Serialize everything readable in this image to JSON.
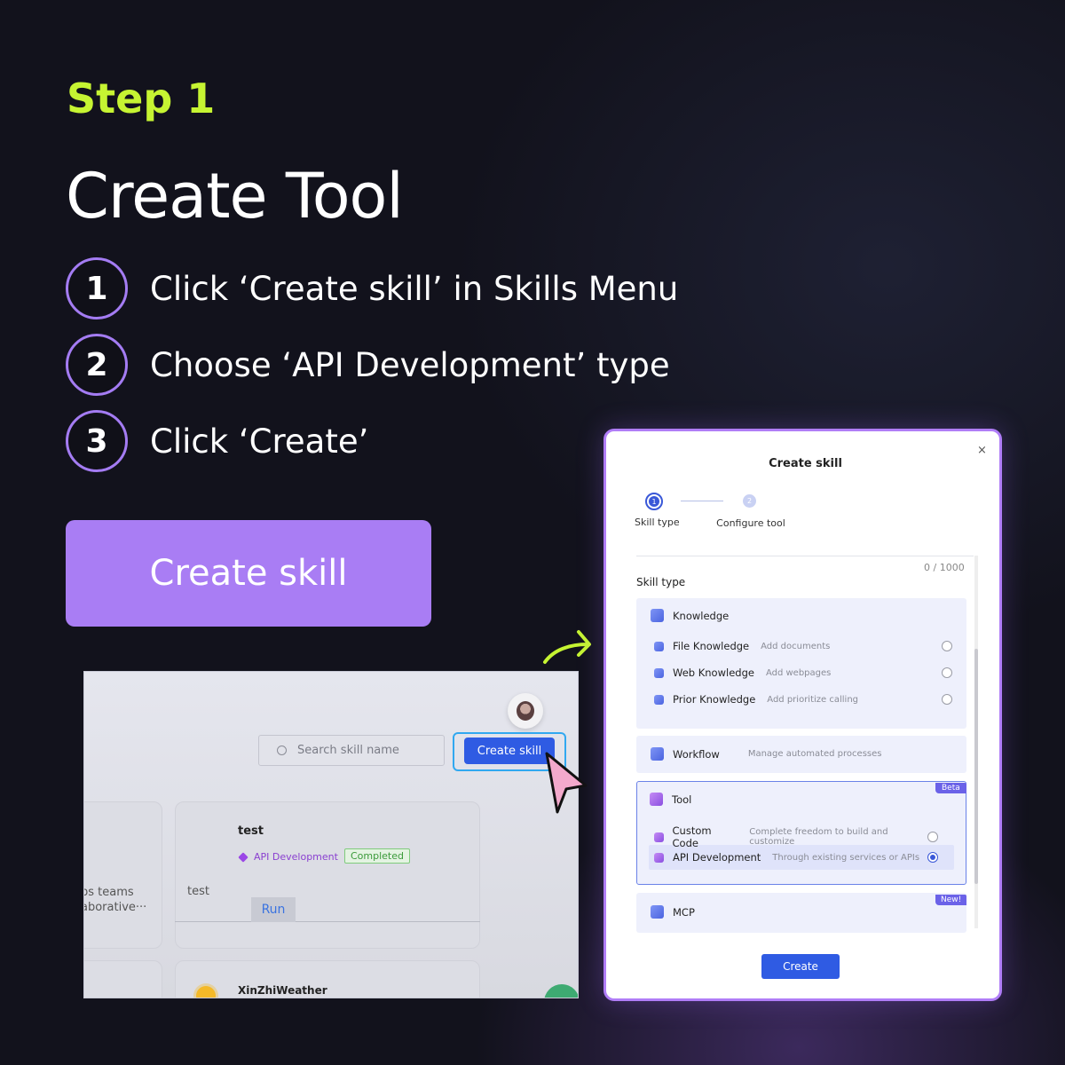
{
  "header": {
    "step_label": "Step 1",
    "title": "Create Tool"
  },
  "steps": [
    {
      "number": "1",
      "text": "Click ‘Create skill’ in Skills Menu"
    },
    {
      "number": "2",
      "text": "Choose ‘API Development’ type"
    },
    {
      "number": "3",
      "text": "Click ‘Create’"
    }
  ],
  "cta_label": "Create skill",
  "screenshot": {
    "search_placeholder": "Search skill name",
    "create_button": "Create skill",
    "card": {
      "name": "test",
      "tag": "API Development",
      "status": "Completed",
      "description": "test",
      "run_label": "Run"
    },
    "truncated_lines": [
      "ps teams",
      "aborative···"
    ],
    "second_card_name": "XinZhiWeather"
  },
  "dialog": {
    "title": "Create skill",
    "close": "×",
    "stepper": [
      {
        "num": "1",
        "label": "Skill type"
      },
      {
        "num": "2",
        "label": "Configure tool"
      }
    ],
    "counter": "0 / 1000",
    "section_label": "Skill type",
    "knowledge": {
      "title": "Knowledge",
      "items": [
        {
          "name": "File Knowledge",
          "desc": "Add documents"
        },
        {
          "name": "Web Knowledge",
          "desc": "Add webpages"
        },
        {
          "name": "Prior Knowledge",
          "desc": "Add prioritize calling"
        }
      ]
    },
    "workflow": {
      "name": "Workflow",
      "desc": "Manage automated processes"
    },
    "tool": {
      "title": "Tool",
      "badge": "Beta",
      "items": [
        {
          "name": "Custom Code",
          "desc": "Complete freedom to build and customize",
          "selected": false
        },
        {
          "name": "API Development",
          "desc": "Through existing services or APIs",
          "selected": true
        }
      ]
    },
    "mcp": {
      "name": "MCP",
      "badge": "New!"
    },
    "create_button": "Create"
  },
  "colors": {
    "accent_green": "#c6f432",
    "accent_purple": "#a97df4",
    "primary_blue": "#2f5be3",
    "background": "#12121c"
  }
}
